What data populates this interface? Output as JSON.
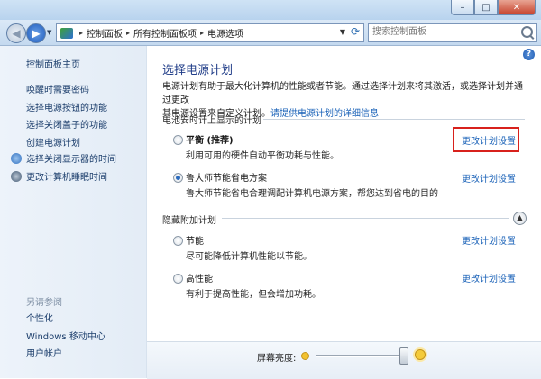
{
  "window": {
    "caption_buttons": {
      "minimize": "–",
      "maximize": "□",
      "close": "✕"
    }
  },
  "address_bar": {
    "breadcrumbs": [
      "控制面板",
      "所有控制面板项",
      "电源选项"
    ],
    "search_placeholder": "搜索控制面板",
    "icons": [
      "back-arrow-icon",
      "forward-arrow-icon",
      "control-panel-icon",
      "refresh-icon",
      "search-icon"
    ]
  },
  "sidebar": {
    "home": "控制面板主页",
    "links": [
      "唤醒时需要密码",
      "选择电源按钮的功能",
      "选择关闭盖子的功能",
      "创建电源计划"
    ],
    "icon_links": [
      "选择关闭显示器的时间",
      "更改计算机睡眠时间"
    ],
    "see_also_heading": "另请参阅",
    "see_also": [
      "个性化",
      "Windows 移动中心",
      "用户帐户"
    ]
  },
  "main": {
    "title": "选择电源计划",
    "desc_line1": "电源计划有助于最大化计算机的性能或者节能。通过选择计划来将其激活，或选择计划并通过更改",
    "desc_line2_prefix": "其电源设置来自定义计划。",
    "desc_link": "请提供电源计划的详细信息",
    "section_shown": "电池安时计上显示的计划",
    "section_hidden": "隐藏附加计划",
    "change_link": "更改计划设置",
    "plans": [
      {
        "name": "平衡 (推荐)",
        "desc": "利用可用的硬件自动平衡功耗与性能。",
        "selected": false
      },
      {
        "name": "鲁大师节能省电方案",
        "desc": "鲁大师节能省电合理调配计算机电源方案，帮您达到省电的目的",
        "selected": true
      },
      {
        "name": "节能",
        "desc": "尽可能降低计算机性能以节能。",
        "selected": false
      },
      {
        "name": "高性能",
        "desc": "有利于提高性能，但会增加功耗。",
        "selected": false
      }
    ],
    "highlight_color": "#d8211c"
  },
  "brightness": {
    "label": "屏幕亮度:",
    "level_percent": 97
  }
}
